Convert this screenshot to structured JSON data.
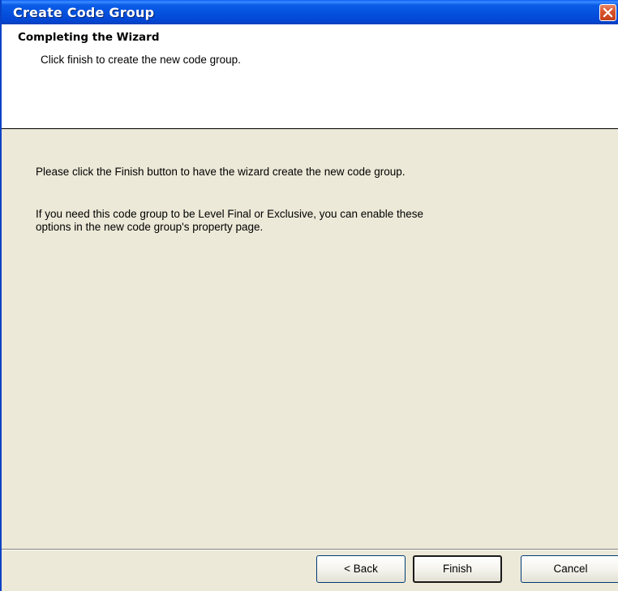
{
  "window": {
    "title": "Create Code Group"
  },
  "header": {
    "title": "Completing the Wizard",
    "subtitle": "Click finish to create the new code group."
  },
  "body": {
    "paragraph1": "Please click the Finish button to have the wizard create the new code group.",
    "paragraph2_line1": "If you need this code group to be Level Final or Exclusive, you can enable these",
    "paragraph2_line2": "options in the new code group's property page."
  },
  "buttons": {
    "back": "< Back",
    "finish": "Finish",
    "cancel": "Cancel"
  },
  "icons": {
    "close": "close-icon"
  },
  "colors": {
    "titlebar": "#0451dd",
    "close_button": "#d9542c",
    "dialog_background": "#ece9d8",
    "header_background": "#ffffff"
  }
}
